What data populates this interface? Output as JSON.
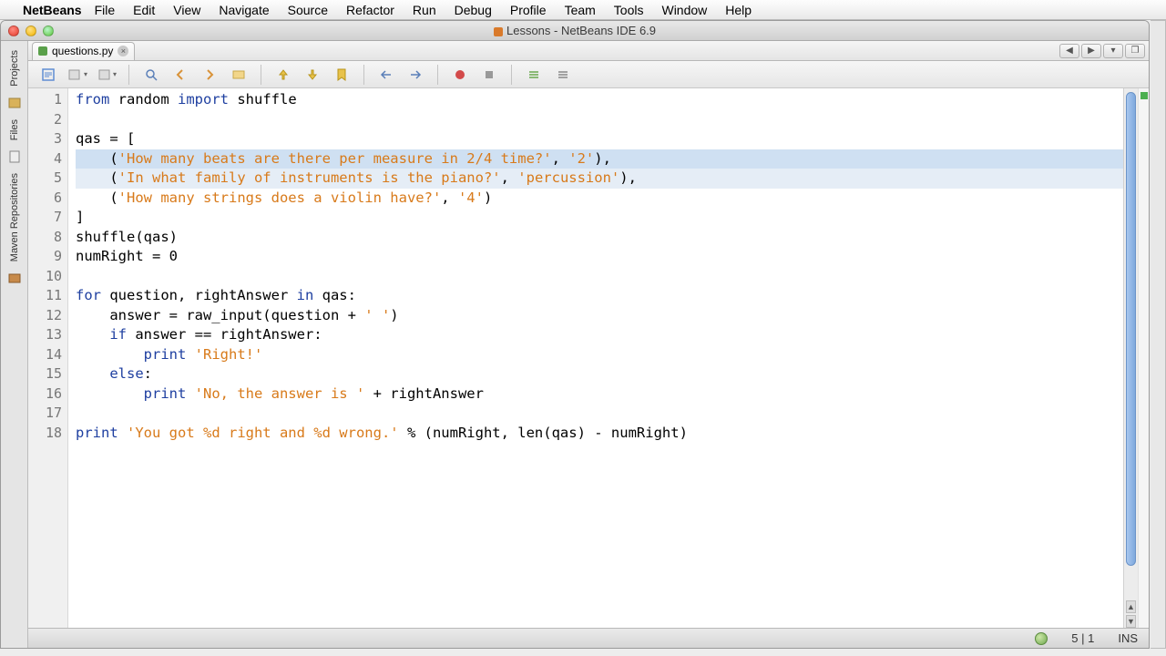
{
  "menubar": {
    "app": "NetBeans",
    "items": [
      "File",
      "Edit",
      "View",
      "Navigate",
      "Source",
      "Refactor",
      "Run",
      "Debug",
      "Profile",
      "Team",
      "Tools",
      "Window",
      "Help"
    ]
  },
  "window": {
    "title": "Lessons - NetBeans IDE 6.9"
  },
  "sidebar": {
    "tabs": [
      "Projects",
      "Files",
      "Maven Repositories"
    ]
  },
  "editor": {
    "tab": {
      "filename": "questions.py"
    },
    "tabnav": {
      "prev": "◀",
      "next": "▶",
      "list": "▾",
      "max": "❐"
    },
    "code": {
      "lines": [
        {
          "n": 1,
          "tokens": [
            {
              "t": "from ",
              "c": "kw"
            },
            {
              "t": "random "
            },
            {
              "t": "import ",
              "c": "kw"
            },
            {
              "t": "shuffle"
            }
          ]
        },
        {
          "n": 2,
          "tokens": []
        },
        {
          "n": 3,
          "tokens": [
            {
              "t": "qas = ["
            }
          ]
        },
        {
          "n": 4,
          "hl": 1,
          "tokens": [
            {
              "t": "    ("
            },
            {
              "t": "'How many beats are there per measure in 2/4 time?'",
              "c": "str"
            },
            {
              "t": ", "
            },
            {
              "t": "'2'",
              "c": "str"
            },
            {
              "t": "),"
            }
          ]
        },
        {
          "n": 5,
          "hl": 2,
          "tokens": [
            {
              "t": "    ("
            },
            {
              "t": "'In what family of instruments is the piano?'",
              "c": "str"
            },
            {
              "t": ", "
            },
            {
              "t": "'percussion'",
              "c": "str"
            },
            {
              "t": "),"
            }
          ]
        },
        {
          "n": 6,
          "tokens": [
            {
              "t": "    ("
            },
            {
              "t": "'How many strings does a violin have?'",
              "c": "str"
            },
            {
              "t": ", "
            },
            {
              "t": "'4'",
              "c": "str"
            },
            {
              "t": ")"
            }
          ]
        },
        {
          "n": 7,
          "tokens": [
            {
              "t": "]"
            }
          ]
        },
        {
          "n": 8,
          "tokens": [
            {
              "t": "shuffle(qas)"
            }
          ]
        },
        {
          "n": 9,
          "tokens": [
            {
              "t": "numRight = 0"
            }
          ]
        },
        {
          "n": 10,
          "tokens": []
        },
        {
          "n": 11,
          "tokens": [
            {
              "t": "for ",
              "c": "kw"
            },
            {
              "t": "question, rightAnswer "
            },
            {
              "t": "in ",
              "c": "kw"
            },
            {
              "t": "qas:"
            }
          ]
        },
        {
          "n": 12,
          "tokens": [
            {
              "t": "    answer = raw_input(question + "
            },
            {
              "t": "' '",
              "c": "str"
            },
            {
              "t": ")"
            }
          ]
        },
        {
          "n": 13,
          "tokens": [
            {
              "t": "    "
            },
            {
              "t": "if ",
              "c": "kw"
            },
            {
              "t": "answer == rightAnswer:"
            }
          ]
        },
        {
          "n": 14,
          "tokens": [
            {
              "t": "        "
            },
            {
              "t": "print ",
              "c": "kw"
            },
            {
              "t": "'Right!'",
              "c": "str"
            }
          ]
        },
        {
          "n": 15,
          "tokens": [
            {
              "t": "    "
            },
            {
              "t": "else",
              "c": "kw"
            },
            {
              "t": ":"
            }
          ]
        },
        {
          "n": 16,
          "tokens": [
            {
              "t": "        "
            },
            {
              "t": "print ",
              "c": "kw"
            },
            {
              "t": "'No, the answer is '",
              "c": "str"
            },
            {
              "t": " + rightAnswer"
            }
          ]
        },
        {
          "n": 17,
          "tokens": []
        },
        {
          "n": 18,
          "tokens": [
            {
              "t": "print ",
              "c": "kw"
            },
            {
              "t": "'You got %d right and %d wrong.'",
              "c": "str"
            },
            {
              "t": " % (numRight, len(qas) - numRight)"
            }
          ]
        }
      ]
    }
  },
  "status": {
    "pos": "5 | 1",
    "mode": "INS"
  }
}
